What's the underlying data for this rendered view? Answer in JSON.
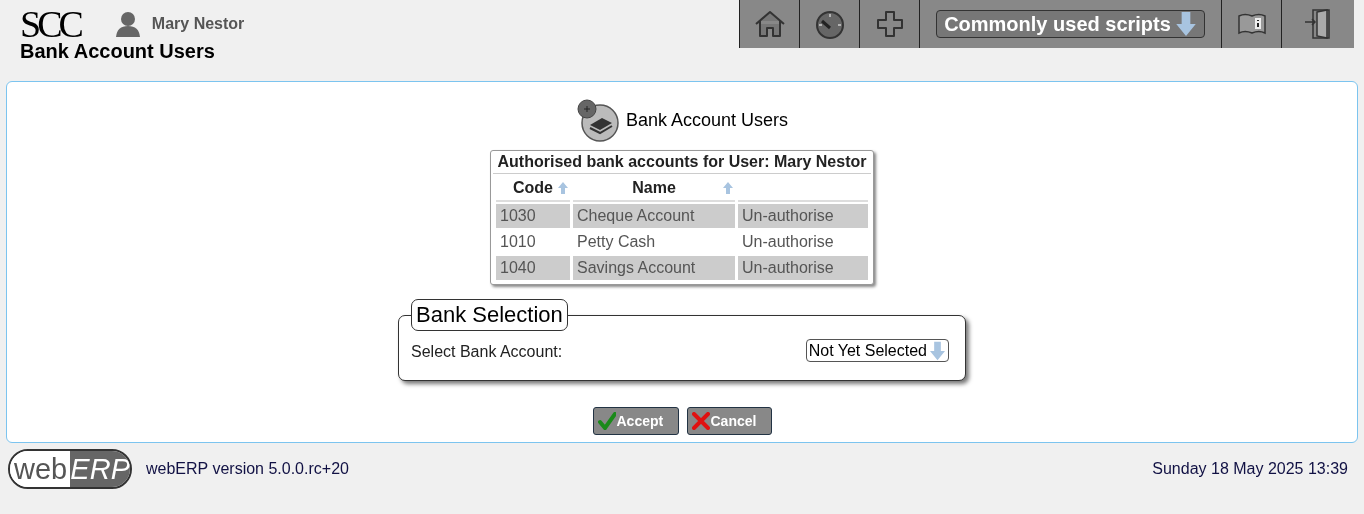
{
  "header": {
    "logo": "SCC",
    "user": "Mary Nestor",
    "page_title": "Bank Account Users"
  },
  "toolbar": {
    "items": [
      {
        "kind": "home"
      },
      {
        "kind": "dashboard"
      },
      {
        "kind": "plus"
      },
      {
        "kind": "dropdown",
        "label": "Commonly used scripts"
      },
      {
        "kind": "manual"
      },
      {
        "kind": "logout"
      }
    ]
  },
  "heading": "Bank Account Users",
  "table": {
    "caption": "Authorised bank accounts for User: Mary Nestor",
    "columns": [
      {
        "label": "Code",
        "sortable": true
      },
      {
        "label": "Name",
        "sortable": true
      },
      {
        "sortable": false
      }
    ],
    "rows": [
      [
        "1030",
        "Cheque Account",
        "Un-authorise"
      ],
      [
        "1010",
        "Petty Cash",
        "Un-authorise"
      ],
      [
        "1040",
        "Savings Account",
        "Un-authorise"
      ]
    ]
  },
  "fieldset": {
    "legend": "Bank Selection",
    "label": "Select Bank Account:",
    "select_value": "Not Yet Selected"
  },
  "buttons": [
    {
      "kind": "accept",
      "label": "Accept"
    },
    {
      "kind": "cancel",
      "label": "Cancel"
    }
  ],
  "footer": {
    "logo_left": "web",
    "logo_right": "ERP",
    "version": "webERP version 5.0.0.rc+20",
    "datetime": "Sunday 18 May 2025 13:39"
  }
}
